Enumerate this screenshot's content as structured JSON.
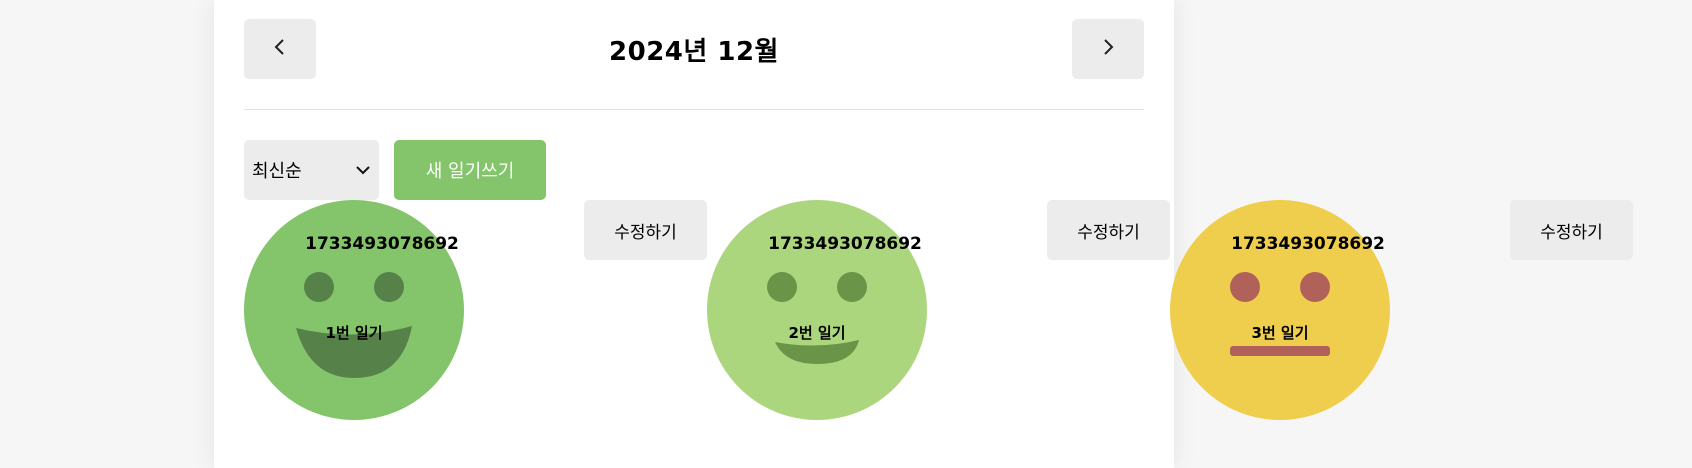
{
  "header": {
    "title": "2024년 12월",
    "prev_icon": "chevron-left-icon",
    "next_icon": "chevron-right-icon"
  },
  "toolbar": {
    "sort_value": "최신순",
    "sort_icon": "chevron-down-icon",
    "new_label": "새 일기쓰기"
  },
  "colors": {
    "accent": "#84c56c",
    "emotion_1": "#84c56c",
    "emotion_2": "#acd67d",
    "emotion_3": "#f0ce4d",
    "button_bg": "#ececec"
  },
  "entries": [
    {
      "date": "1733493078692",
      "content": "1번 일기",
      "edit_label": "수정하기",
      "emotion_icon": "big-smile-face-icon"
    },
    {
      "date": "1733493078692",
      "content": "2번 일기",
      "edit_label": "수정하기",
      "emotion_icon": "smile-face-icon"
    },
    {
      "date": "1733493078692",
      "content": "3번 일기",
      "edit_label": "수정하기",
      "emotion_icon": "neutral-face-icon"
    }
  ]
}
